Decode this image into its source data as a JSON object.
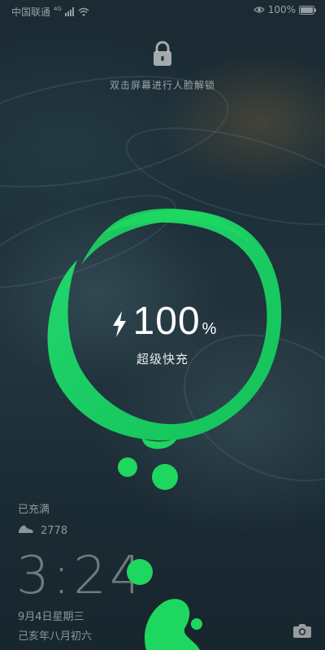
{
  "status_bar": {
    "carrier": "中国联通",
    "signal_type": "4G",
    "battery_percent": "100%",
    "icons": [
      "signal-icon",
      "wifi-icon",
      "eye-icon",
      "battery-icon"
    ]
  },
  "lock": {
    "hint": "双击屏幕进行人脸解锁",
    "icon": "lock-icon"
  },
  "charging": {
    "value": "100",
    "unit": "%",
    "mode": "超级快充",
    "level_fraction": 1.0,
    "accent_color": "#1ed760"
  },
  "info": {
    "charged": "已充满",
    "steps": "2778",
    "time": "3:24",
    "date": "9月4日星期三",
    "lunar_date": "己亥年八月初六"
  },
  "bottom": {
    "camera_icon": "camera-icon"
  }
}
